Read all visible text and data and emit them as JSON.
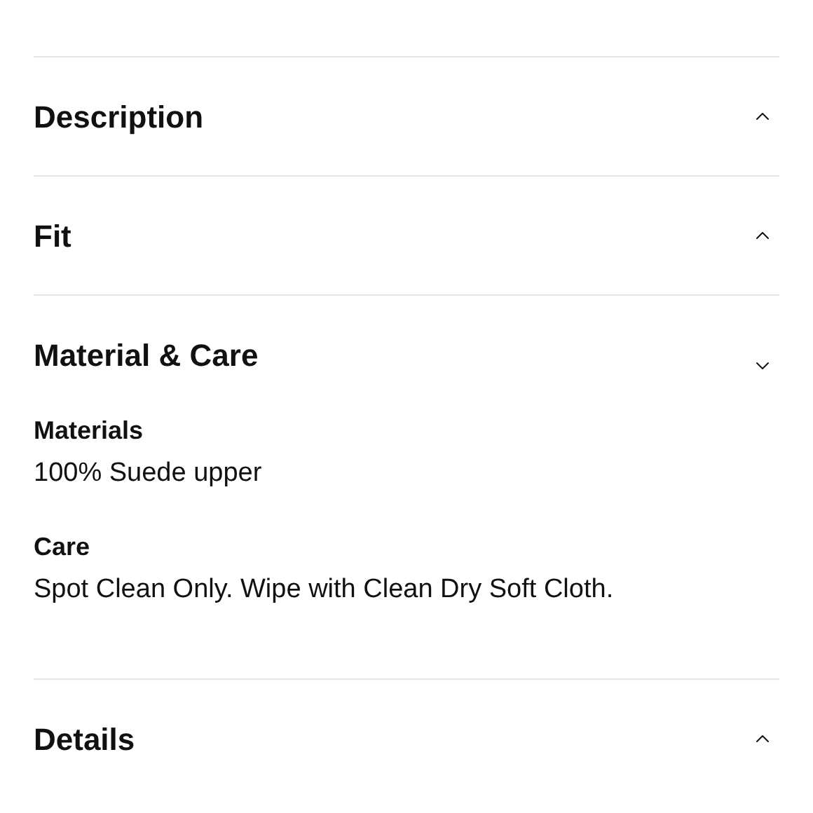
{
  "sections": [
    {
      "title": "Description",
      "expanded": false
    },
    {
      "title": "Fit",
      "expanded": false
    },
    {
      "title": "Material & Care",
      "expanded": true,
      "content": [
        {
          "heading": "Materials",
          "text": "100% Suede upper"
        },
        {
          "heading": "Care",
          "text": "Spot Clean Only. Wipe with Clean Dry Soft Cloth."
        }
      ]
    },
    {
      "title": "Details",
      "expanded": false
    }
  ]
}
